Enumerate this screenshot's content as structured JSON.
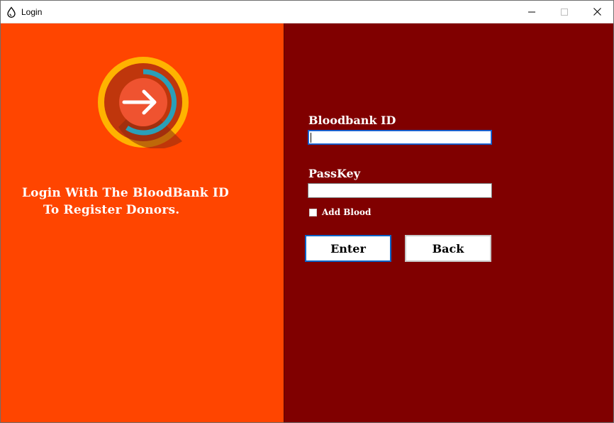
{
  "window": {
    "title": "Login",
    "controls": {
      "minimize": "minimize-icon",
      "maximize": "maximize-icon",
      "close": "close-icon"
    }
  },
  "left": {
    "background": "#ff4500",
    "logo_icon": "login-arrow-icon",
    "message_line1": "Login With The BloodBank ID",
    "message_line2": "To Register Donors."
  },
  "form": {
    "background": "#800000",
    "id_label": "Bloodbank ID",
    "id_value": "",
    "pass_label": "PassKey",
    "pass_value": "",
    "checkbox_label": "Add Blood",
    "checkbox_checked": false,
    "enter_label": "Enter",
    "back_label": "Back"
  }
}
